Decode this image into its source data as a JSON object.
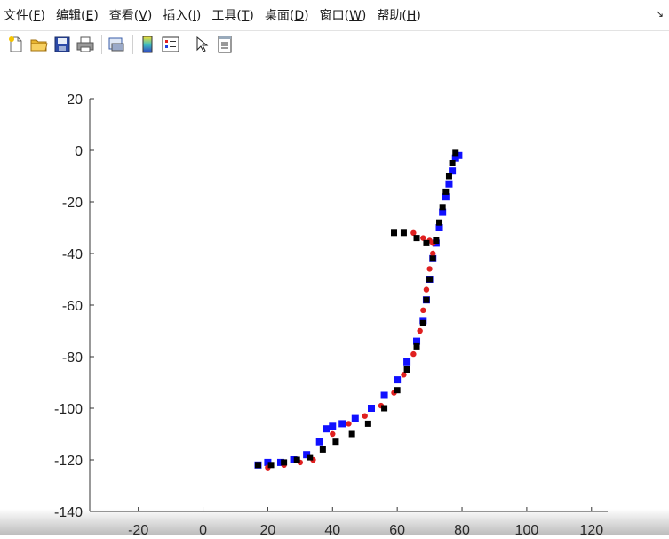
{
  "menu": [
    {
      "label": "文件",
      "key": "F"
    },
    {
      "label": "编辑",
      "key": "E"
    },
    {
      "label": "查看",
      "key": "V"
    },
    {
      "label": "插入",
      "key": "I"
    },
    {
      "label": "工具",
      "key": "T"
    },
    {
      "label": "桌面",
      "key": "D"
    },
    {
      "label": "窗口",
      "key": "W"
    },
    {
      "label": "帮助",
      "key": "H"
    }
  ],
  "toolbar": [
    "new-file-icon",
    "open-folder-icon",
    "save-icon",
    "print-icon",
    "print-preview-icon",
    "colorbar-icon",
    "legend-icon",
    "pointer-icon",
    "property-inspector-icon"
  ],
  "chart_data": {
    "type": "scatter",
    "title": "",
    "xlabel": "",
    "ylabel": "",
    "xlim": [
      -35,
      125
    ],
    "ylim": [
      -140,
      20
    ],
    "xticks": [
      -20,
      0,
      20,
      40,
      60,
      80,
      100,
      120
    ],
    "yticks": [
      20,
      0,
      -20,
      -40,
      -60,
      -80,
      -100,
      -120,
      -140
    ],
    "grid": false,
    "series": [
      {
        "color": "#1010ff",
        "marker": "square",
        "x": [
          17,
          20,
          24,
          28,
          32,
          36,
          38,
          40,
          43,
          47,
          52,
          56,
          60,
          63,
          66,
          68,
          69,
          70,
          71,
          72,
          73,
          74,
          75,
          76,
          77,
          78,
          79
        ],
        "y": [
          -122,
          -121,
          -121,
          -120,
          -118,
          -113,
          -108,
          -107,
          -106,
          -104,
          -100,
          -95,
          -89,
          -82,
          -74,
          -66,
          -58,
          -50,
          -42,
          -36,
          -30,
          -24,
          -18,
          -13,
          -8,
          -3,
          -2
        ]
      },
      {
        "color": "#e02020",
        "marker": "dot",
        "x": [
          20,
          25,
          30,
          34,
          37,
          40,
          45,
          50,
          55,
          59,
          62,
          65,
          67,
          68,
          69,
          70,
          71,
          71,
          70,
          68,
          65,
          62
        ],
        "y": [
          -123,
          -122,
          -121,
          -120,
          -116,
          -110,
          -106,
          -103,
          -99,
          -94,
          -87,
          -79,
          -70,
          -62,
          -54,
          -46,
          -40,
          -36,
          -35,
          -34,
          -32,
          -32
        ]
      },
      {
        "color": "#000000",
        "marker": "square",
        "x": [
          17,
          21,
          25,
          29,
          33,
          37,
          41,
          46,
          51,
          56,
          60,
          63,
          66,
          68,
          69,
          70,
          71,
          72,
          73,
          74,
          75,
          76,
          77,
          78,
          69,
          66,
          62,
          59
        ],
        "y": [
          -122,
          -122,
          -121,
          -120,
          -119,
          -116,
          -113,
          -110,
          -106,
          -100,
          -93,
          -85,
          -76,
          -67,
          -58,
          -50,
          -42,
          -35,
          -28,
          -22,
          -16,
          -10,
          -5,
          -1,
          -36,
          -34,
          -32,
          -32
        ]
      }
    ]
  }
}
